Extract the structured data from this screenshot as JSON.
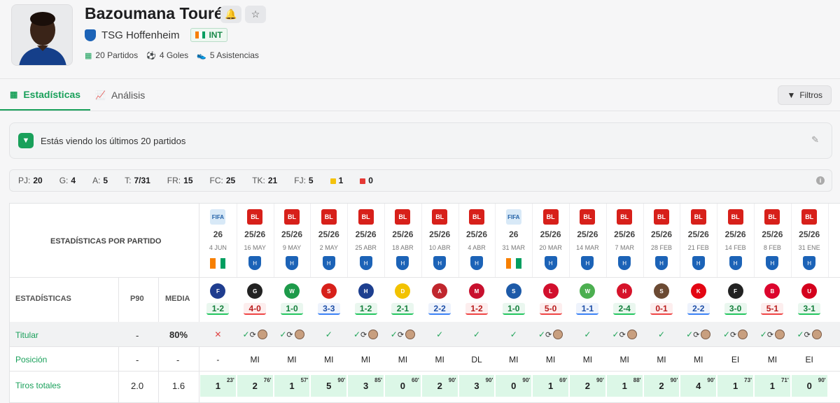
{
  "player": {
    "name": "Bazoumana Touré",
    "club": "TSG Hoffenheim",
    "nat_badge": "INT",
    "stats": {
      "matches": "20 Partidos",
      "goals": "4 Goles",
      "assists": "5 Asistencias"
    }
  },
  "tabs": [
    {
      "label": "Estadísticas",
      "icon": "table-icon",
      "active": true
    },
    {
      "label": "Análisis",
      "icon": "chart-icon",
      "active": false
    }
  ],
  "filter_button": "Filtros",
  "notice": "Estás viendo los últimos 20 partidos",
  "summary": [
    {
      "k": "PJ:",
      "v": "20"
    },
    {
      "k": "G:",
      "v": "4"
    },
    {
      "k": "A:",
      "v": "5"
    },
    {
      "k": "T:",
      "v": "7/31"
    },
    {
      "k": "FR:",
      "v": "15"
    },
    {
      "k": "FC:",
      "v": "25"
    },
    {
      "k": "TK:",
      "v": "21"
    },
    {
      "k": "FJ:",
      "v": "5"
    },
    {
      "k": "",
      "v": "1",
      "color": "#f4c20d"
    },
    {
      "k": "",
      "v": "0",
      "color": "#e53935"
    }
  ],
  "table": {
    "title": "ESTADÍSTICAS POR PARTIDO",
    "headers": {
      "stats": "ESTADÍSTICAS",
      "p90": "P90",
      "media": "MEDIA"
    },
    "rows": [
      {
        "label": "Titular",
        "p90": "-",
        "media": "80%"
      },
      {
        "label": "Posición",
        "p90": "-",
        "media": "-"
      },
      {
        "label": "Tiros totales",
        "p90": "2.0",
        "media": "1.6"
      }
    ],
    "matches": [
      {
        "comp": "fifa",
        "season": "26",
        "date": "4 JUN",
        "team": "ci",
        "opp": "France",
        "oppc": "#1f3d8f",
        "score": "1-2",
        "res": "sl_win",
        "starter": "x",
        "pos": "-",
        "shots": "1",
        "min": "23'"
      },
      {
        "comp": "bl",
        "season": "25/26",
        "date": "16 MAY",
        "team": "hof",
        "opp": "Gladbach",
        "oppc": "#222",
        "score": "4-0",
        "res": "sl",
        "starter": "cs",
        "pos": "MI",
        "shots": "2",
        "min": "76'"
      },
      {
        "comp": "bl",
        "season": "25/26",
        "date": "9 MAY",
        "team": "hof",
        "opp": "Werder",
        "oppc": "#1d9a4a",
        "score": "1-0",
        "res": "sw",
        "starter": "cs",
        "pos": "MI",
        "shots": "1",
        "min": "57'"
      },
      {
        "comp": "bl",
        "season": "25/26",
        "date": "2 MAY",
        "team": "hof",
        "opp": "Stuttgart",
        "oppc": "#d7201a",
        "score": "3-3",
        "res": "sd",
        "starter": "c",
        "pos": "MI",
        "shots": "5",
        "min": "90'"
      },
      {
        "comp": "bl",
        "season": "25/26",
        "date": "25 ABR",
        "team": "hof",
        "opp": "Hamburg",
        "oppc": "#1d3f8f",
        "score": "1-2",
        "res": "sw",
        "starter": "cs",
        "pos": "MI",
        "shots": "3",
        "min": "85'"
      },
      {
        "comp": "bl",
        "season": "25/26",
        "date": "18 ABR",
        "team": "hof",
        "opp": "Dortmund",
        "oppc": "#f2c200",
        "score": "2-1",
        "res": "sw",
        "starter": "cs",
        "pos": "MI",
        "shots": "0",
        "min": "60'"
      },
      {
        "comp": "bl",
        "season": "25/26",
        "date": "10 ABR",
        "team": "hof",
        "opp": "Augsburg",
        "oppc": "#c0262d",
        "score": "2-2",
        "res": "sd",
        "starter": "c",
        "pos": "MI",
        "shots": "2",
        "min": "90'"
      },
      {
        "comp": "bl",
        "season": "25/26",
        "date": "4 ABR",
        "team": "hof",
        "opp": "Mainz",
        "oppc": "#c8102e",
        "score": "1-2",
        "res": "sl",
        "starter": "c",
        "pos": "DL",
        "shots": "3",
        "min": "90'"
      },
      {
        "comp": "fifa",
        "season": "26",
        "date": "31 MAR",
        "team": "ci",
        "opp": "Scotland",
        "oppc": "#1d5aa8",
        "score": "1-0",
        "res": "sw",
        "starter": "c",
        "pos": "MI",
        "shots": "0",
        "min": "90'"
      },
      {
        "comp": "bl",
        "season": "25/26",
        "date": "20 MAR",
        "team": "hof",
        "opp": "Leipzig",
        "oppc": "#d20f2d",
        "score": "5-0",
        "res": "sl",
        "starter": "cs",
        "pos": "MI",
        "shots": "1",
        "min": "69'"
      },
      {
        "comp": "bl",
        "season": "25/26",
        "date": "14 MAR",
        "team": "hof",
        "opp": "Wolfsburg",
        "oppc": "#4caf50",
        "score": "1-1",
        "res": "sd",
        "starter": "c",
        "pos": "MI",
        "shots": "2",
        "min": "90'"
      },
      {
        "comp": "bl",
        "season": "25/26",
        "date": "7 MAR",
        "team": "hof",
        "opp": "Heidenheim",
        "oppc": "#d6132a",
        "score": "2-4",
        "res": "sw",
        "starter": "cs",
        "pos": "MI",
        "shots": "1",
        "min": "88'"
      },
      {
        "comp": "bl",
        "season": "25/26",
        "date": "28 FEB",
        "team": "hof",
        "opp": "St. Pauli",
        "oppc": "#6b4a33",
        "score": "0-1",
        "res": "sl",
        "starter": "c",
        "pos": "MI",
        "shots": "2",
        "min": "90'"
      },
      {
        "comp": "bl",
        "season": "25/26",
        "date": "21 FEB",
        "team": "hof",
        "opp": "Köln",
        "oppc": "#e30613",
        "score": "2-2",
        "res": "sd",
        "starter": "cs",
        "pos": "MI",
        "shots": "4",
        "min": "90'"
      },
      {
        "comp": "bl",
        "season": "25/26",
        "date": "14 FEB",
        "team": "hof",
        "opp": "Freiburg",
        "oppc": "#222",
        "score": "3-0",
        "res": "sw",
        "starter": "cs",
        "pos": "EI",
        "shots": "1",
        "min": "73'"
      },
      {
        "comp": "bl",
        "season": "25/26",
        "date": "8 FEB",
        "team": "hof",
        "opp": "Bayern",
        "oppc": "#dc052d",
        "score": "5-1",
        "res": "sl",
        "starter": "cs",
        "pos": "MI",
        "shots": "1",
        "min": "71'"
      },
      {
        "comp": "bl",
        "season": "25/26",
        "date": "31 ENE",
        "team": "hof",
        "opp": "Union",
        "oppc": "#d4011d",
        "score": "3-1",
        "res": "sw",
        "starter": "cs",
        "pos": "EI",
        "shots": "0",
        "min": "90'"
      }
    ]
  },
  "colors": {
    "accent": "#19a05a",
    "bundesliga": "#d7201a",
    "hoffenheim": "#1c63b7"
  }
}
